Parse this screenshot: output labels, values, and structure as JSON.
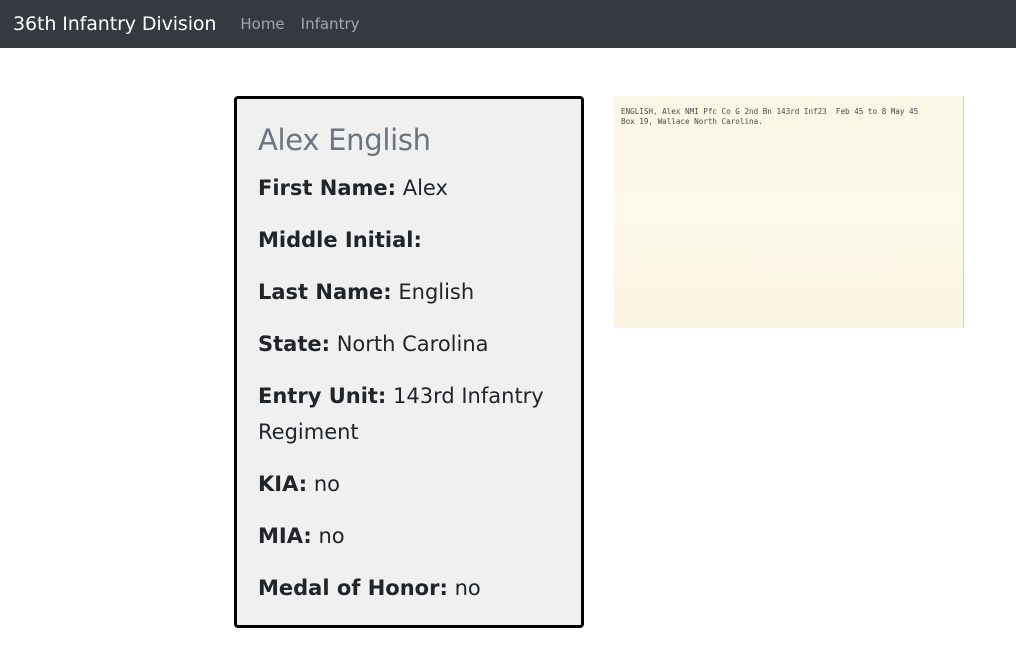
{
  "navbar": {
    "brand": "36th Infantry Division",
    "links": [
      {
        "label": "Home"
      },
      {
        "label": "Infantry"
      }
    ]
  },
  "soldier": {
    "name": "Alex English",
    "fields": [
      {
        "label": "First Name:",
        "value": "Alex"
      },
      {
        "label": "Middle Initial:",
        "value": ""
      },
      {
        "label": "Last Name:",
        "value": "English"
      },
      {
        "label": "State:",
        "value": "North Carolina"
      },
      {
        "label": "Entry Unit:",
        "value": "143rd Infantry Regiment"
      },
      {
        "label": "KIA:",
        "value": "no"
      },
      {
        "label": "MIA:",
        "value": "no"
      },
      {
        "label": "Medal of Honor:",
        "value": "no"
      }
    ]
  },
  "record_card": {
    "line1": "ENGLISH, Alex NMI Pfc Co G 2nd Bn 143rd Inf23  Feb 45 to 8 May 45",
    "line2": "Box 19, Wallace North Carolina."
  },
  "colors": {
    "navbar_bg": "#343a40",
    "card_bg": "#f0f0f0",
    "title_color": "#6c757d"
  }
}
